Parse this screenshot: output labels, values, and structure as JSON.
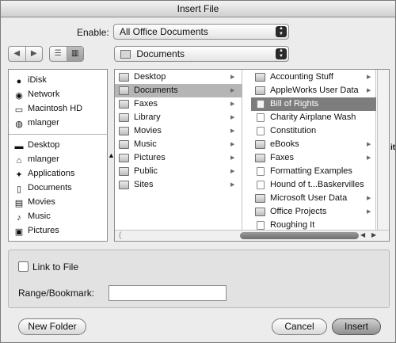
{
  "window": {
    "title": "Insert File"
  },
  "enable": {
    "label": "Enable:",
    "value": "All Office Documents"
  },
  "location": {
    "value": "Documents"
  },
  "nav": {
    "back_icon": "back-arrow-icon",
    "forward_icon": "forward-arrow-icon"
  },
  "view": {
    "list_icon": "list-view-icon",
    "column_icon": "column-view-icon",
    "active": "column"
  },
  "sidebar": {
    "devices": [
      {
        "label": "iDisk",
        "icon": "idisk-icon"
      },
      {
        "label": "Network",
        "icon": "network-icon"
      },
      {
        "label": "Macintosh HD",
        "icon": "hard-disk-icon"
      },
      {
        "label": "mlanger",
        "icon": "user-disk-icon"
      }
    ],
    "places": [
      {
        "label": "Desktop",
        "icon": "desktop-icon"
      },
      {
        "label": "mlanger",
        "icon": "home-icon"
      },
      {
        "label": "Applications",
        "icon": "applications-icon"
      },
      {
        "label": "Documents",
        "icon": "documents-icon"
      },
      {
        "label": "Movies",
        "icon": "movies-icon"
      },
      {
        "label": "Music",
        "icon": "music-icon"
      },
      {
        "label": "Pictures",
        "icon": "pictures-icon"
      }
    ]
  },
  "column1": {
    "items": [
      {
        "label": "Desktop",
        "folder": true
      },
      {
        "label": "Documents",
        "folder": true,
        "selected": true
      },
      {
        "label": "Faxes",
        "folder": true
      },
      {
        "label": "Library",
        "folder": true
      },
      {
        "label": "Movies",
        "folder": true
      },
      {
        "label": "Music",
        "folder": true
      },
      {
        "label": "Pictures",
        "folder": true
      },
      {
        "label": "Public",
        "folder": true
      },
      {
        "label": "Sites",
        "folder": true
      }
    ]
  },
  "column2": {
    "items": [
      {
        "label": "Accounting Stuff",
        "folder": true
      },
      {
        "label": "AppleWorks User Data",
        "folder": true
      },
      {
        "label": "Bill of Rights",
        "folder": false,
        "highlighted": true
      },
      {
        "label": "Charity Airplane Wash",
        "folder": false
      },
      {
        "label": "Constitution",
        "folder": false
      },
      {
        "label": "eBooks",
        "folder": true
      },
      {
        "label": "Faxes",
        "folder": true
      },
      {
        "label": "Formatting Examples",
        "folder": false
      },
      {
        "label": "Hound of t...Baskervilles",
        "folder": false
      },
      {
        "label": "Microsoft User Data",
        "folder": true
      },
      {
        "label": "Office Projects",
        "folder": true
      },
      {
        "label": "Roughing It",
        "folder": false
      }
    ]
  },
  "cutoff_text": "it",
  "options": {
    "link_label": "Link to File",
    "link_checked": false,
    "range_label": "Range/Bookmark:",
    "range_value": ""
  },
  "buttons": {
    "new_folder": "New Folder",
    "cancel": "Cancel",
    "insert": "Insert"
  },
  "colors": {
    "selection": "#b5b5b5",
    "highlight": "#7d7d7d",
    "default_button": "#8f8f8f"
  }
}
